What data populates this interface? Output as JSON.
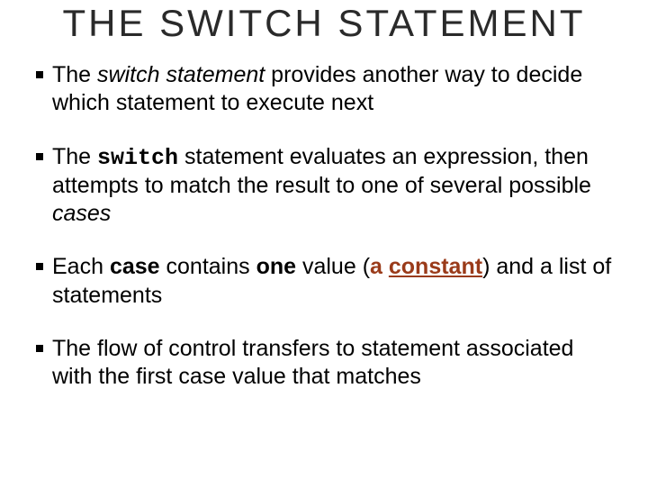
{
  "title": "THE SWITCH STATEMENT",
  "bullets": {
    "b1": {
      "t1": "The ",
      "switch": "switch",
      "stmt": " statement",
      "rest": " provides another way to decide which statement to execute next"
    },
    "b2": {
      "t1": "The ",
      "switch": "switch",
      "rest1": " statement evaluates an expression, then attempts to match the result to one of several possible ",
      "cases": "cases"
    },
    "b3": {
      "t1": "Each ",
      "case": "case",
      "mid": " contains ",
      "one": "one",
      "val": " value (",
      "a": "a ",
      "constant": "constant",
      "close": ") and a list of statements"
    },
    "b4": {
      "t1": "The flow of control transfers to statement associated with the first case value that matches"
    }
  }
}
